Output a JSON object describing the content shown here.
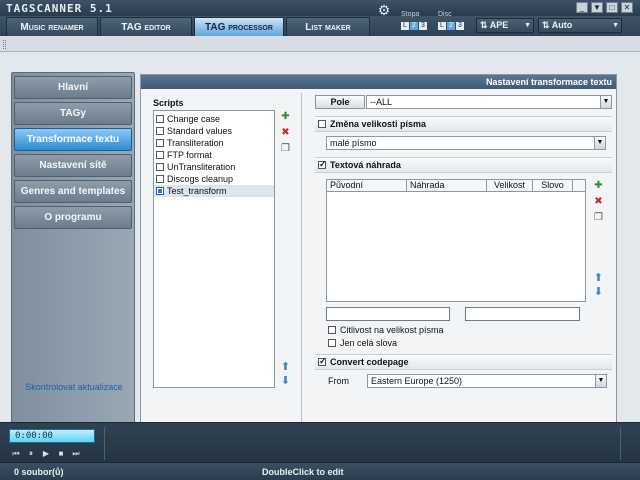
{
  "app": {
    "title": "TAGSCANNER 5.1",
    "window_buttons": [
      "_",
      "▼",
      "□",
      "✕"
    ]
  },
  "tabs": [
    {
      "label": "Music renamer"
    },
    {
      "label": "TAG editor"
    },
    {
      "label": "TAG processor",
      "active": true
    },
    {
      "label": "List maker"
    }
  ],
  "top_controls": {
    "stopa_label": "Stopa",
    "stopa_options": [
      "L",
      "2",
      "3"
    ],
    "disc_label": "Disc",
    "disc_options": [
      "L",
      "2",
      "3"
    ],
    "format_value": "APE",
    "mode_value": "Auto"
  },
  "sidebar": {
    "items": [
      {
        "label": "Hlavní"
      },
      {
        "label": "TAGy"
      },
      {
        "label": "Transformace textu",
        "active": true
      },
      {
        "label": "Nastavení sítě"
      },
      {
        "label": "Genres and templates"
      },
      {
        "label": "O programu"
      }
    ],
    "update_link": "Skontrolovat aktualizace"
  },
  "panel": {
    "header": "Nastavení transformace textu",
    "scripts_label": "Scripts",
    "scripts": [
      {
        "label": "Change case"
      },
      {
        "label": "Standard values"
      },
      {
        "label": "Transliteration"
      },
      {
        "label": "FTP format"
      },
      {
        "label": "UnTransliteration"
      },
      {
        "label": "Discogs cleanup"
      },
      {
        "label": "Test_transform",
        "selected": true
      }
    ],
    "pole_label": "Pole",
    "pole_value": "--ALL",
    "case_section": {
      "label": "Změna velikosti písma",
      "checked": false
    },
    "case_value": "malé písmo",
    "replace_section": {
      "label": "Textová náhrada",
      "checked": true
    },
    "grid_columns": [
      "Původní",
      "Náhrada",
      "Velikost",
      "Slovo"
    ],
    "case_sensitive_label": "Citlivost na velikost písma",
    "whole_words_label": "Jen celá slova",
    "codepage_section": {
      "label": "Convert codepage",
      "checked": true
    },
    "from_label": "From",
    "from_value": "Eastern Europe (1250)"
  },
  "player": {
    "time": "0:00:00",
    "controls": [
      "⏮",
      "⏸",
      "▶",
      "■",
      "⏭"
    ]
  },
  "status": {
    "file_count": "0 soubor(ů)",
    "hint": "DoubleClick to edit"
  }
}
